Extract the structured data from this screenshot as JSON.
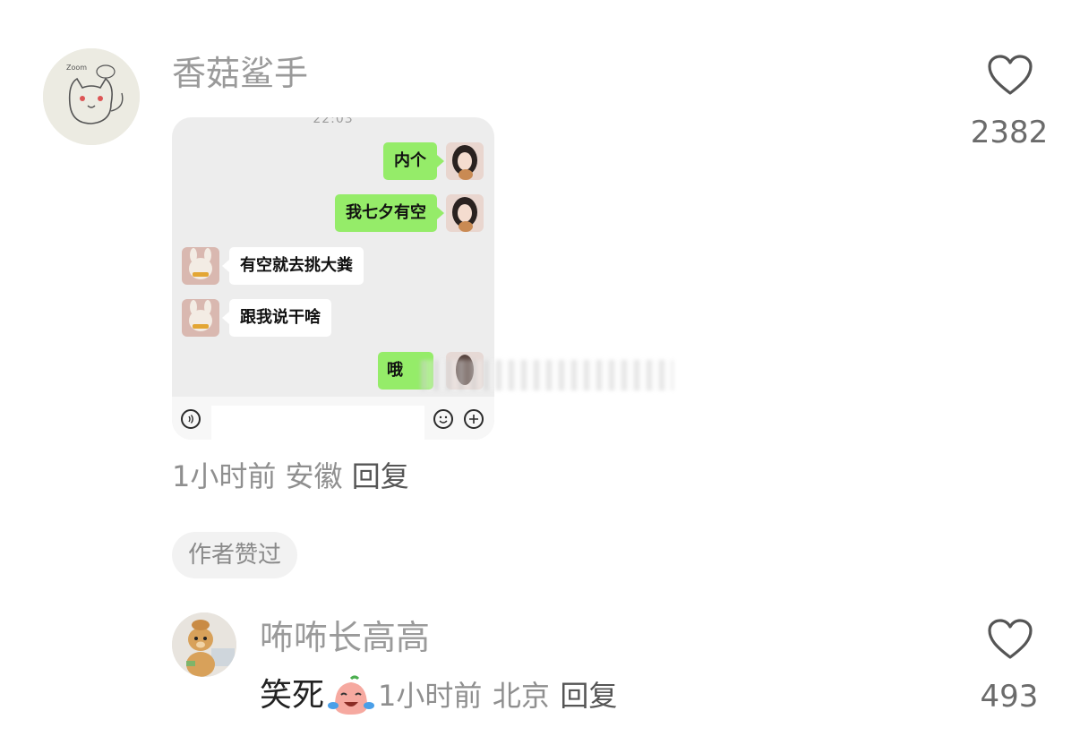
{
  "comments": [
    {
      "username": "香菇鲨手",
      "avatar_icon": "cat-doodle-avatar",
      "avatar_text": "Zoom",
      "like_count": "2382",
      "screenshot": {
        "time": "22:03",
        "messages": [
          {
            "side": "me",
            "text": "内个"
          },
          {
            "side": "me",
            "text": "我七夕有空"
          },
          {
            "side": "other",
            "text": "有空就去挑大粪"
          },
          {
            "side": "other",
            "text": "跟我说干啥"
          },
          {
            "side": "me",
            "text": "哦"
          }
        ]
      },
      "time": "1小时前",
      "location": "安徽",
      "reply_label": "回复",
      "badge": "作者赞过"
    },
    {
      "username": "咘咘长高高",
      "avatar_icon": "bear-photo-avatar",
      "text": "笑死",
      "emoji": "laughing-crying-emoji",
      "time": "1小时前",
      "location": "北京",
      "reply_label": "回复",
      "like_count": "493"
    }
  ],
  "colors": {
    "bubble_me": "#95ec69",
    "bubble_other": "#ffffff",
    "username": "#9a9a9a",
    "badge_bg": "#f2f2f2"
  }
}
